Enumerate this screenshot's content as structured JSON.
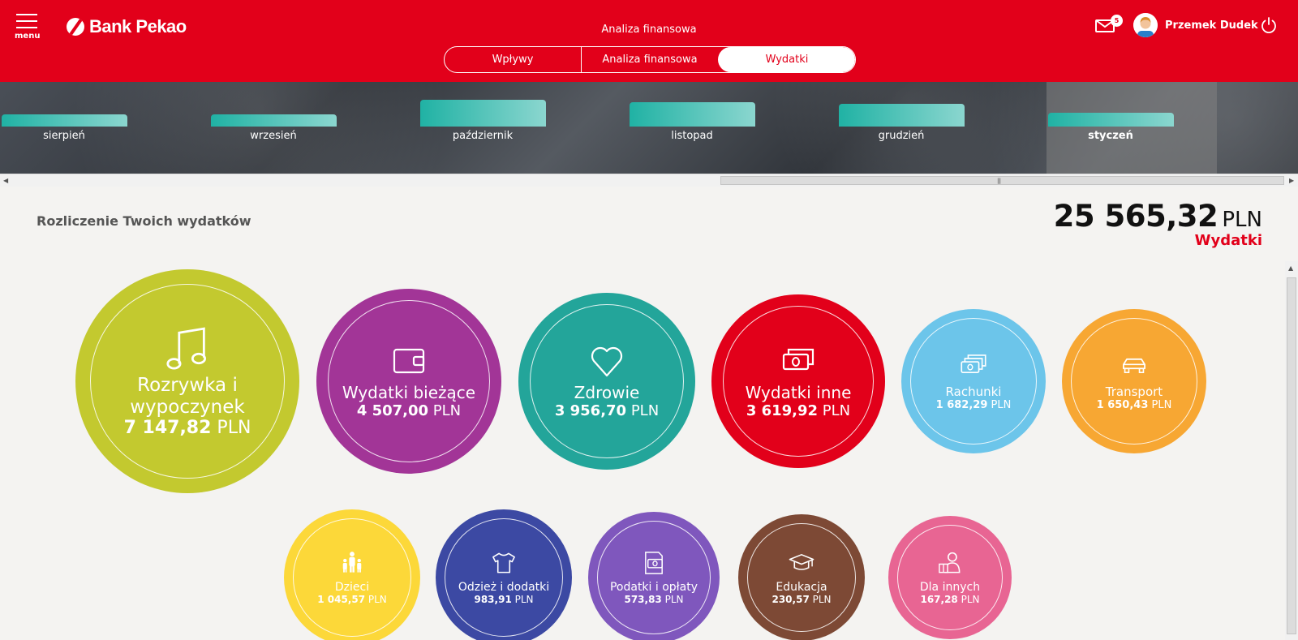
{
  "header": {
    "menu_label": "menu",
    "logo": "Bank Pekao",
    "page_title": "Analiza finansowa",
    "tabs": [
      {
        "label": "Wpływy",
        "active": false
      },
      {
        "label": "Analiza finansowa",
        "active": false
      },
      {
        "label": "Wydatki",
        "active": true
      }
    ],
    "messages_count": "5",
    "user_name": "Przemek Dudek",
    "brand_color": "#e2001a"
  },
  "months": [
    {
      "label": "sierpień",
      "level": 0.25,
      "selected": false
    },
    {
      "label": "wrzesień",
      "level": 0.25,
      "selected": false
    },
    {
      "label": "październik",
      "level": 0.55,
      "selected": false
    },
    {
      "label": "listopad",
      "level": 0.5,
      "selected": false
    },
    {
      "label": "grudzień",
      "level": 0.47,
      "selected": false
    },
    {
      "label": "styczeń",
      "level": 0.29,
      "selected": true
    }
  ],
  "summary": {
    "title": "Rozliczenie Twoich wydatków",
    "total_amount": "25 565,32",
    "total_currency": "PLN",
    "total_label": "Wydatki"
  },
  "categories": [
    {
      "name": "Rozrywka i wypoczynek",
      "amount": "7 147,82",
      "currency": "PLN",
      "icon": "music-note-icon",
      "color": "#c3c92f"
    },
    {
      "name": "Wydatki bieżące",
      "amount": "4 507,00",
      "currency": "PLN",
      "icon": "wallet-icon",
      "color": "#a23597"
    },
    {
      "name": "Zdrowie",
      "amount": "3 956,70",
      "currency": "PLN",
      "icon": "heart-icon",
      "color": "#23a59a"
    },
    {
      "name": "Wydatki inne",
      "amount": "3 619,92",
      "currency": "PLN",
      "icon": "banknotes-icon",
      "color": "#e2001a"
    },
    {
      "name": "Rachunki",
      "amount": "1 682,29",
      "currency": "PLN",
      "icon": "bills-icon",
      "color": "#6cc5ea"
    },
    {
      "name": "Transport",
      "amount": "1 650,43",
      "currency": "PLN",
      "icon": "car-icon",
      "color": "#f7a733"
    },
    {
      "name": "Dzieci",
      "amount": "1 045,57",
      "currency": "PLN",
      "icon": "family-icon",
      "color": "#fcd839"
    },
    {
      "name": "Odzież i dodatki",
      "amount": "983,91",
      "currency": "PLN",
      "icon": "tshirt-icon",
      "color": "#3c49a3"
    },
    {
      "name": "Podatki i opłaty",
      "amount": "573,83",
      "currency": "PLN",
      "icon": "tax-document-icon",
      "color": "#7f57bd"
    },
    {
      "name": "Edukacja",
      "amount": "230,57",
      "currency": "PLN",
      "icon": "graduation-cap-icon",
      "color": "#7d4935"
    },
    {
      "name": "Dla innych",
      "amount": "167,28",
      "currency": "PLN",
      "icon": "gift-person-icon",
      "color": "#e86593"
    }
  ]
}
